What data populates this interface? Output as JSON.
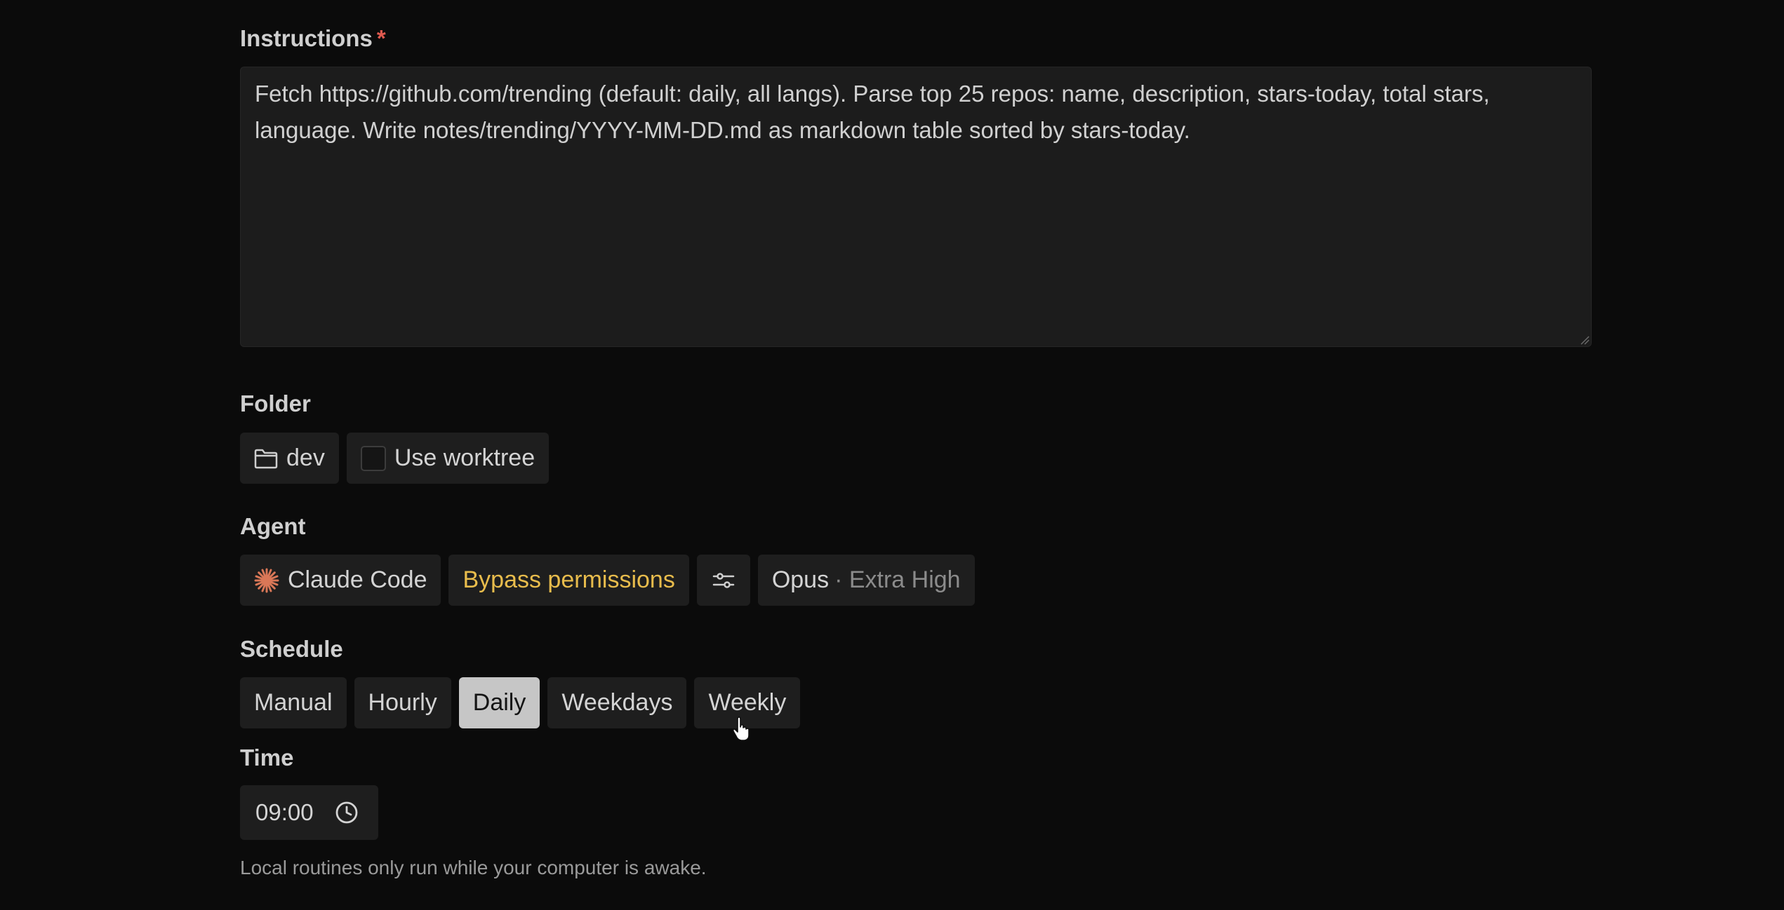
{
  "instructions": {
    "label": "Instructions",
    "required_mark": "*",
    "value": "Fetch https://github.com/trending (default: daily, all langs). Parse top 25 repos: name, description, stars-today, total stars, language. Write notes/trending/YYYY-MM-DD.md as markdown table sorted by stars-today."
  },
  "folder": {
    "label": "Folder",
    "folder_name": "dev",
    "folder_icon": "folder-icon",
    "worktree_label": "Use worktree",
    "worktree_checked": false
  },
  "agent": {
    "label": "Agent",
    "agent_name": "Claude Code",
    "agent_icon": "claude-starburst-icon",
    "agent_icon_color": "#d97757",
    "permission_mode": "Bypass permissions",
    "permission_color": "#e8bc4c",
    "settings_icon": "sliders-icon",
    "model": "Opus",
    "effort": "· Extra High"
  },
  "schedule": {
    "label": "Schedule",
    "options": [
      "Manual",
      "Hourly",
      "Daily",
      "Weekdays",
      "Weekly"
    ],
    "selected": "Daily"
  },
  "time": {
    "label": "Time",
    "value": "09:00",
    "clock_icon": "clock-icon"
  },
  "footnote": "Local routines only run while your computer is awake."
}
